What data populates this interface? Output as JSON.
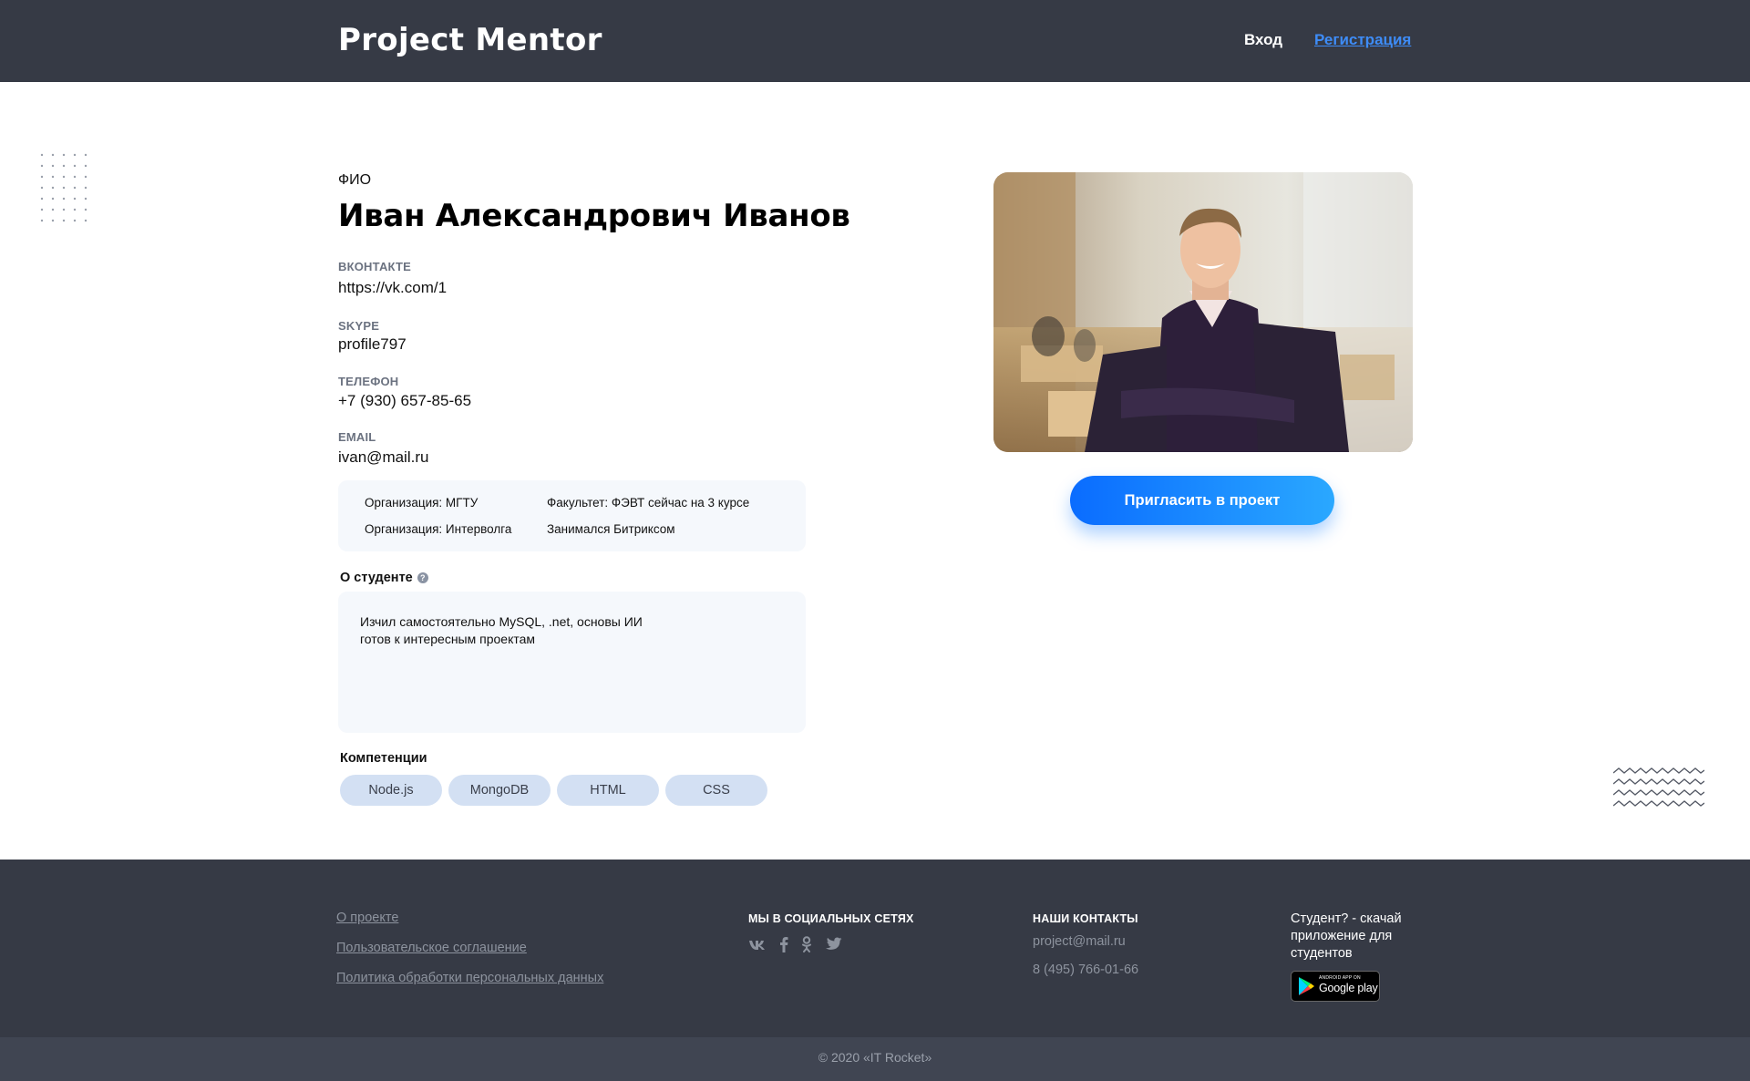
{
  "header": {
    "brand": "Project Mentor",
    "login": "Вход",
    "register": "Регистрация"
  },
  "profile": {
    "fio_label": "ФИО",
    "name": "Иван Александрович Иванов",
    "fields": [
      {
        "label": "ВКОНТАКТЕ",
        "value": "https://vk.com/1"
      },
      {
        "label": "SKYPE",
        "value": "profile797"
      },
      {
        "label": "ТЕЛЕФОН",
        "value": "+7 (930) 657-85-65"
      },
      {
        "label": "EMAIL",
        "value": "ivan@mail.ru"
      }
    ],
    "organizations": [
      {
        "org": "Организация: МГТУ",
        "detail": "Факультет: ФЭВТ сейчас на 3 курсе"
      },
      {
        "org": "Организация: Интерволга",
        "detail": "Занимался Битриксом"
      }
    ],
    "about_title": "О студенте",
    "about_lines": [
      "Изчил самостоятельно MySQL, .net, основы ИИ",
      "готов к интересным проектам"
    ],
    "skills_title": "Компетенции",
    "skills": [
      "Node.js",
      "MongoDB",
      "HTML",
      "CSS"
    ],
    "invite_button": "Пригласить в проект"
  },
  "footer": {
    "links": [
      "О проекте ",
      "Пользовательское соглашение ",
      "Политика обработки персональных данных"
    ],
    "social_heading": "МЫ В СОЦИАЛЬНЫХ СЕТЯХ",
    "social_icons": [
      "vk-icon",
      "facebook-icon",
      "odnoklassniki-icon",
      "twitter-icon"
    ],
    "contacts_heading": "НАШИ КОНТАКТЫ",
    "email": "project@mail.ru",
    "phone": "8 (495) 766-01-66",
    "app_text": "Студент? - скачай приложение для студентов",
    "gplay_small": "ANDROID APP ON",
    "gplay_big": "Google play",
    "copyright": "© 2020 «IT Rocket»"
  },
  "colors": {
    "header_bg": "#363a45",
    "accent": "#3e8cf7",
    "button_gradient": [
      "#0a6cff",
      "#2aa8ff"
    ],
    "chip_bg": "#d3e0f3"
  }
}
